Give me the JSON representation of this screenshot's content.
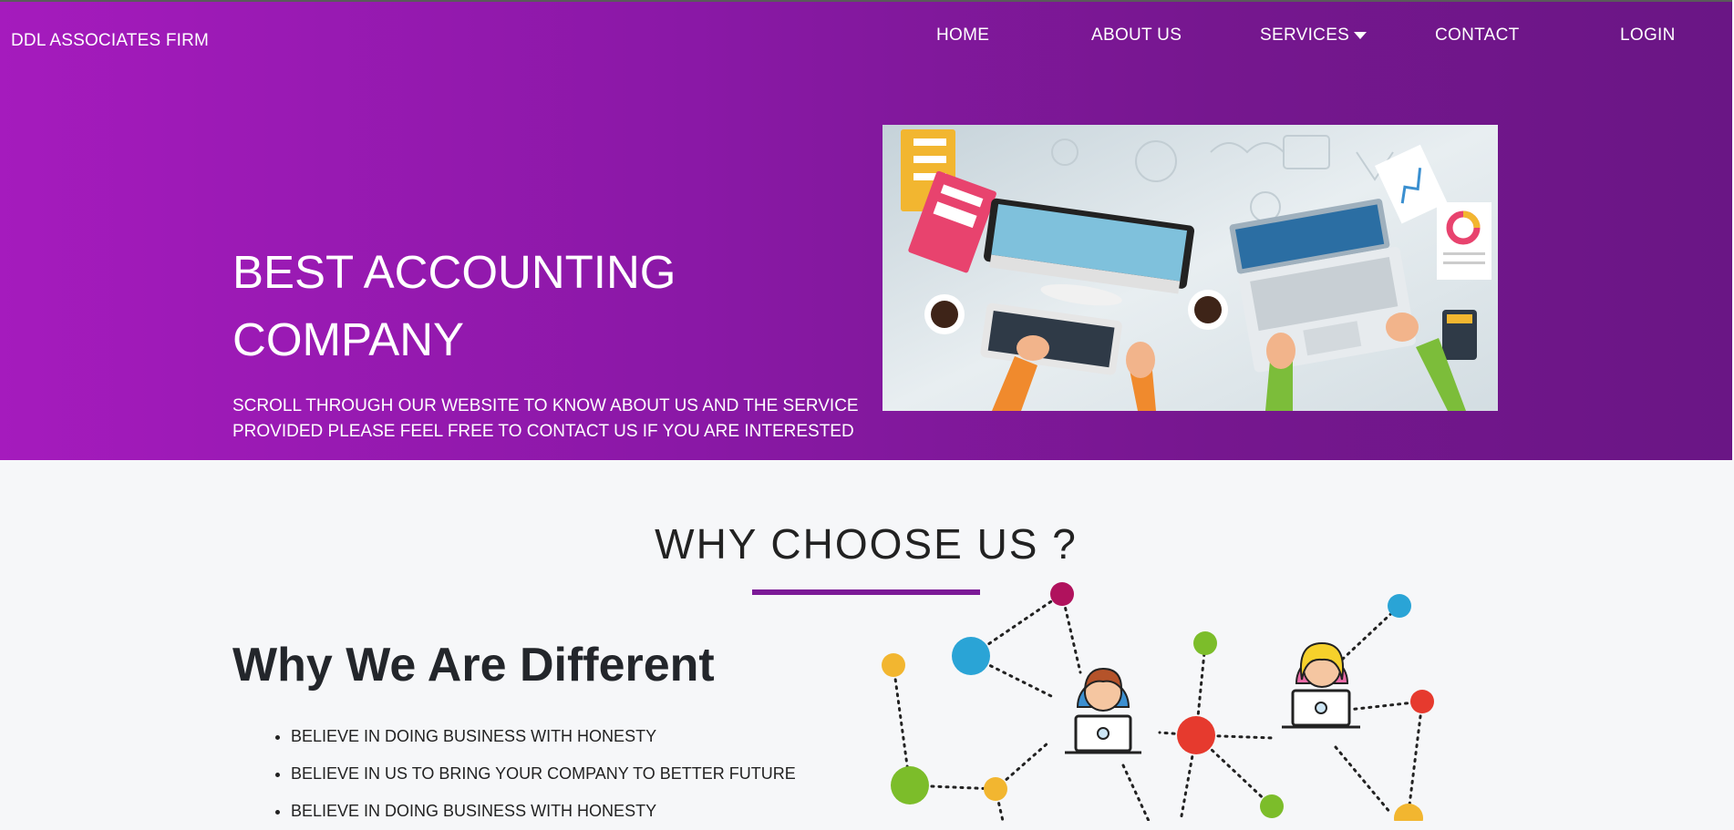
{
  "header": {
    "brand": "DDL ASSOCIATES FIRM",
    "nav": [
      {
        "label": "HOME"
      },
      {
        "label": "ABOUT US"
      },
      {
        "label": "SERVICES"
      },
      {
        "label": "CONTACT"
      },
      {
        "label": "LOGIN"
      }
    ]
  },
  "hero": {
    "title": "BEST ACCOUNTING COMPANY",
    "subtitle": "SCROLL THROUGH OUR WEBSITE TO KNOW ABOUT US AND THE SERVICE PROVIDED PLEASE FEEL FREE TO CONTACT US IF YOU ARE INTERESTED"
  },
  "why": {
    "section_title": "WHY CHOOSE US ?",
    "heading": "Why We Are Different",
    "points": [
      "BELIEVE IN DOING BUSINESS WITH HONESTY",
      "BELIEVE IN US TO BRING YOUR COMPANY TO BETTER FUTURE",
      "BELIEVE IN DOING BUSINESS WITH HONESTY"
    ]
  },
  "colors": {
    "hero_gradient_start": "#a51bbd",
    "hero_gradient_end": "#6a1685",
    "accent": "#7b1a97",
    "page_bg": "#f6f7f9"
  }
}
